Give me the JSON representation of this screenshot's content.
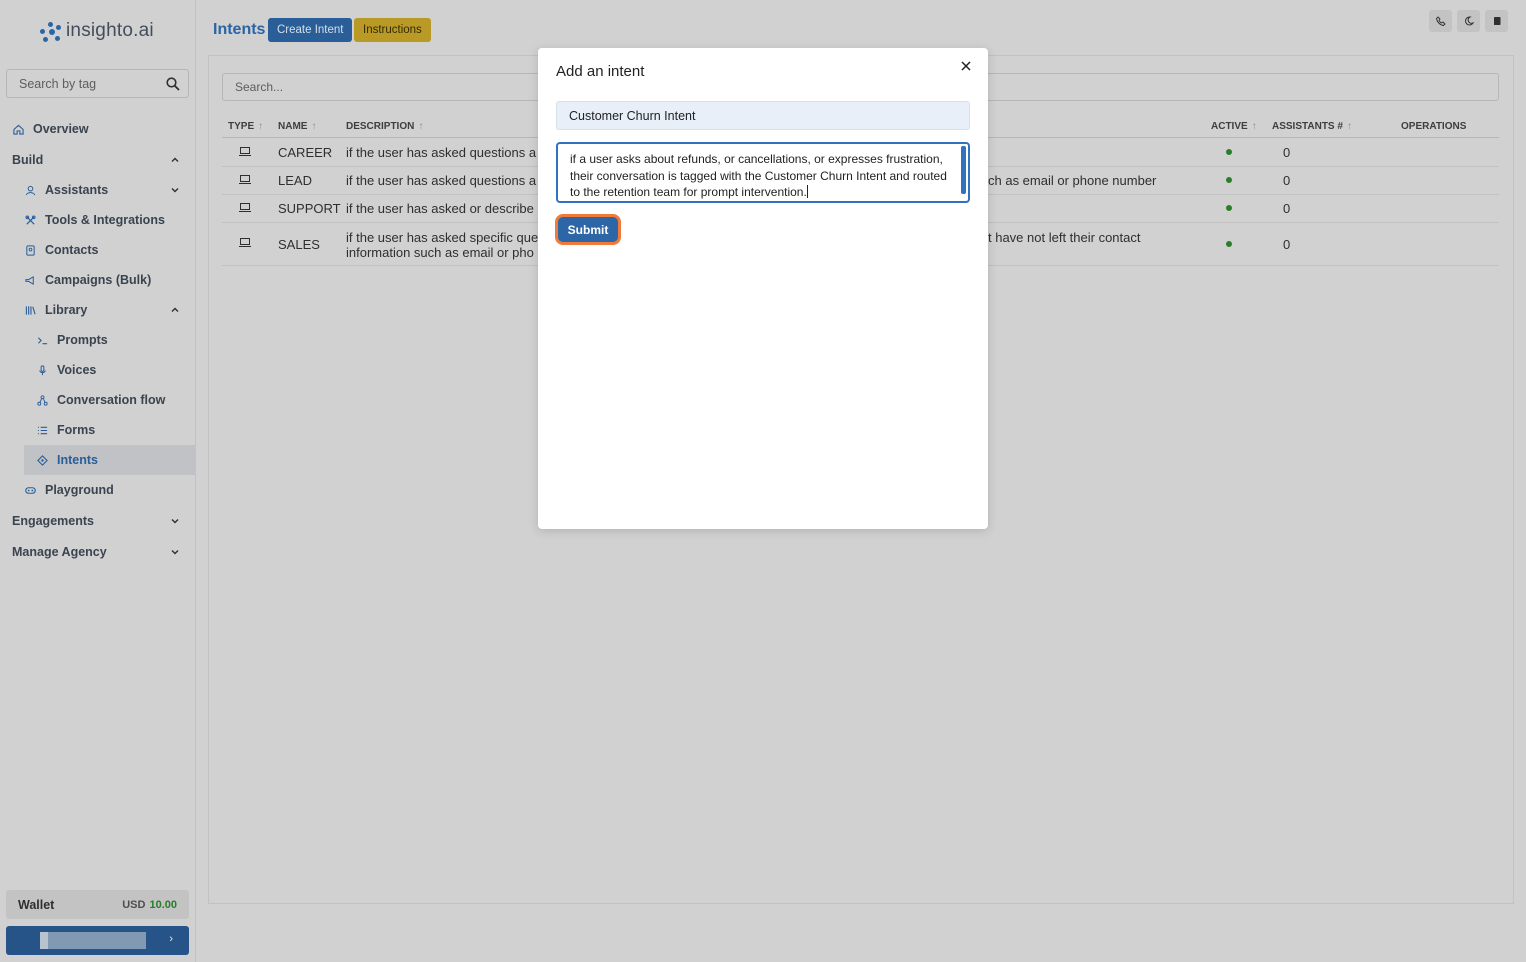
{
  "app": {
    "logo_text": "insighto.ai"
  },
  "sidebar": {
    "search_placeholder": "Search by tag",
    "overview": "Overview",
    "build": "Build",
    "assistants": "Assistants",
    "tools": "Tools & Integrations",
    "contacts": "Contacts",
    "campaigns": "Campaigns (Bulk)",
    "library": "Library",
    "prompts": "Prompts",
    "voices": "Voices",
    "conversation_flow": "Conversation flow",
    "forms": "Forms",
    "intents": "Intents",
    "playground": "Playground",
    "engagements": "Engagements",
    "manage_agency": "Manage Agency",
    "wallet_label": "Wallet",
    "wallet_currency": "USD",
    "wallet_amount": "10.00"
  },
  "header": {
    "title": "Intents",
    "create_button": "Create Intent",
    "instructions_button": "Instructions"
  },
  "main": {
    "search_placeholder": "Search...",
    "columns": {
      "type": "TYPE",
      "name": "NAME",
      "description": "DESCRIPTION",
      "active": "ACTIVE",
      "assistants": "ASSISTANTS #",
      "operations": "OPERATIONS"
    },
    "rows": [
      {
        "name": "CAREER",
        "desc_left": "if the user has asked questions a",
        "desc_right": "",
        "assistants": "0"
      },
      {
        "name": "LEAD",
        "desc_left": "if the user has asked questions a",
        "desc_right": "ch as email or phone number",
        "assistants": "0"
      },
      {
        "name": "SUPPORT",
        "desc_left": "if the user has asked or describe",
        "desc_right": "",
        "assistants": "0"
      },
      {
        "name": "SALES",
        "desc_left": "if the user has asked specific que",
        "desc_left2": "information such as email or pho",
        "desc_right": "t have not left their contact",
        "assistants": "0"
      }
    ]
  },
  "modal": {
    "title": "Add an intent",
    "name_value": "Customer Churn Intent",
    "description_value": "if a user asks about refunds, or cancellations, or expresses frustration, their conversation is tagged with the Customer Churn Intent and routed to the retention team for prompt intervention.",
    "submit_label": "Submit"
  },
  "colors": {
    "accent": "#2d66a6",
    "instructions": "#c9a82a",
    "active_dot": "#2c8a2c",
    "focus_ring": "#f07a3a"
  }
}
